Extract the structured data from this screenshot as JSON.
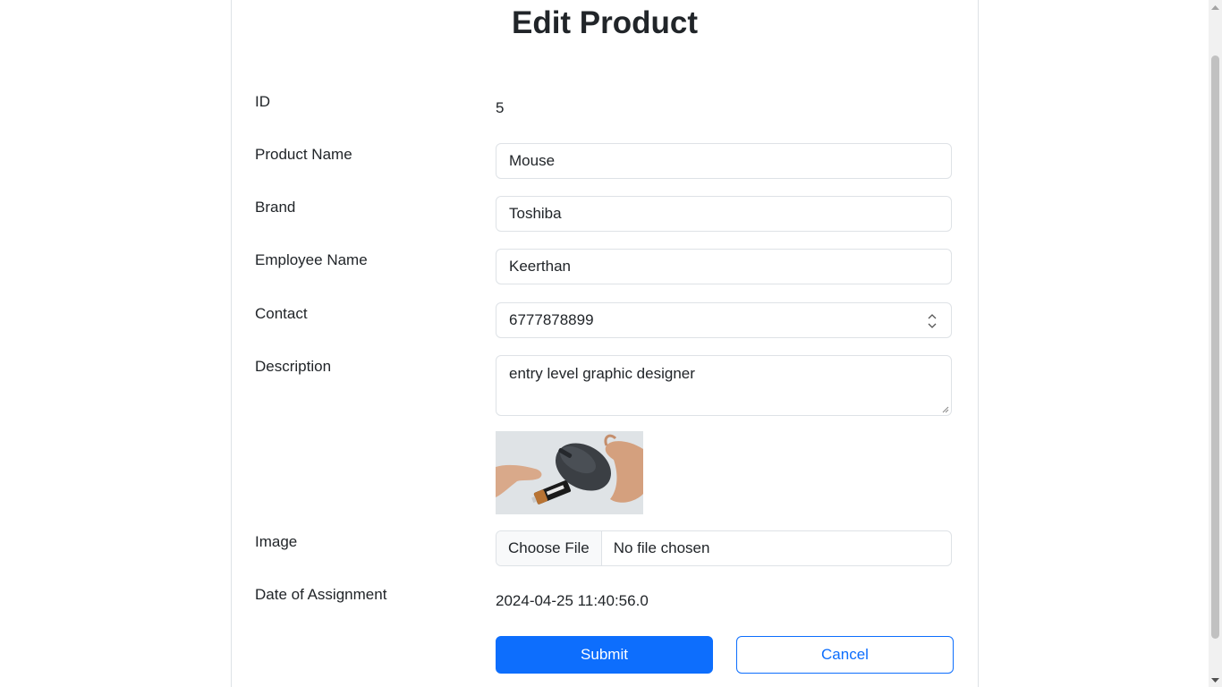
{
  "page": {
    "title": "Edit Product"
  },
  "form": {
    "id": {
      "label": "ID",
      "value": "5"
    },
    "product_name": {
      "label": "Product Name",
      "value": "Mouse"
    },
    "brand": {
      "label": "Brand",
      "value": "Toshiba"
    },
    "employee_name": {
      "label": "Employee Name",
      "value": "Keerthan"
    },
    "contact": {
      "label": "Contact",
      "value": "6777878899"
    },
    "description": {
      "label": "Description",
      "value": "entry level graphic designer"
    },
    "image": {
      "label": "Image",
      "choose_button": "Choose File",
      "status": "No file chosen",
      "preview_alt": "Mouse product photo"
    },
    "date_of_assignment": {
      "label": "Date of Assignment",
      "value": "2024-04-25 11:40:56.0"
    }
  },
  "actions": {
    "submit_label": "Submit",
    "cancel_label": "Cancel"
  },
  "colors": {
    "primary": "#0d6efd",
    "border": "#dee2e6"
  }
}
